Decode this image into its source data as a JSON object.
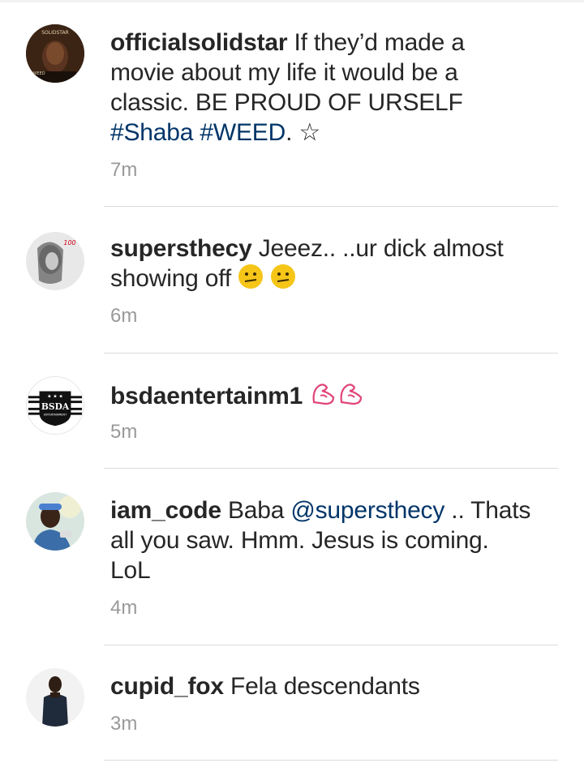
{
  "comments": [
    {
      "username": "officialsolidstar",
      "text_1": " If they’d made a movie about my life it would be a classic. BE PROUD OF URSELF ",
      "hashtag_1": "#Shaba",
      "hashtag_2": "#WEED",
      "text_2": ". ☆",
      "time": "7m",
      "avatar_text_top": "SOLIDSTAR",
      "avatar_text_bottom": "WEED"
    },
    {
      "username": "supersthecy",
      "text_1": " Jeeez.. ..ur dick almost showing off ",
      "emoji": "confused-face-emoji",
      "time": "6m",
      "avatar_badge": "100"
    },
    {
      "username": "bsdaentertainm1",
      "text_1": " ",
      "emoji": "flexed-biceps-emoji",
      "time": "5m",
      "avatar_logo_text": "BSDA",
      "avatar_logo_sub": "ENTERTAINMENT"
    },
    {
      "username": "iam_code",
      "text_1": " Baba ",
      "mention": "@supersthecy",
      "text_2": " .. Thats all you saw. Hmm. Jesus is coming. LoL",
      "time": "4m"
    },
    {
      "username": "cupid_fox",
      "text_1": " Fela descendants",
      "time": "3m"
    }
  ],
  "colors": {
    "text": "#262626",
    "link": "#003569",
    "time": "#999999",
    "divider": "#dbdbdb"
  }
}
